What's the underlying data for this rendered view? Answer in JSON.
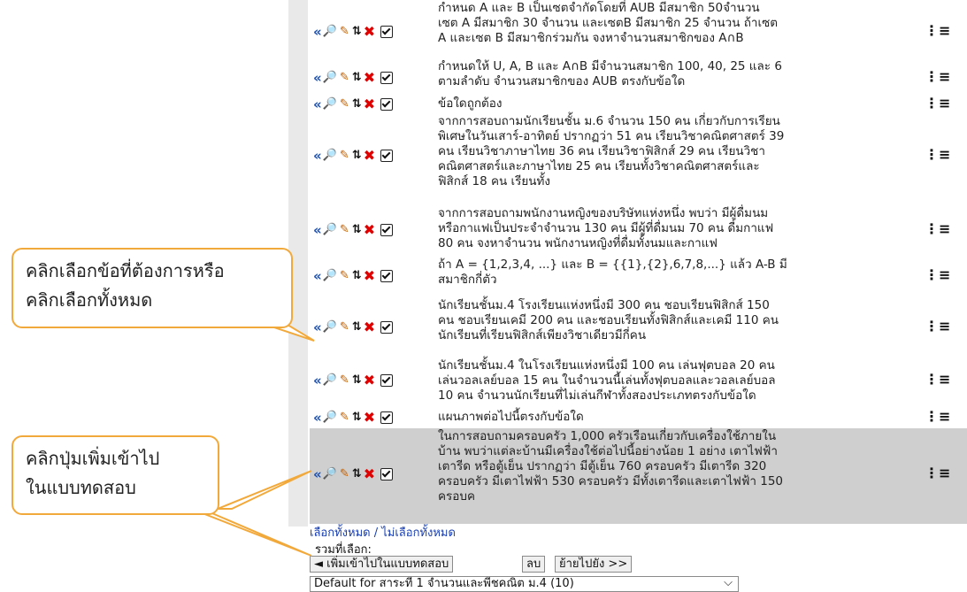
{
  "questions": [
    {
      "text": "กำหนด A และ B เป็นเซตจำกัดโดยที่ AUB มีสมาชิก 50จำนวน\nเซต A มีสมาชิก 30 จำนวน และเซตB มีสมาชิก 25 จำนวน ถ้าเซต\nA และเซต B มีสมาชิกร่วมกัน จงหาจำนวนสมาชิกของ A∩B"
    },
    {
      "text": "กำหนดให้ U, A, B และ A∩B มีจำนวนสมาชิก 100, 40, 25 และ 6\nตามลำดับ จำนวนสมาชิกของ AUB ตรงกับข้อใด"
    },
    {
      "text": "ข้อใดถูกต้อง"
    },
    {
      "text": "จากการสอบถามนักเรียนชั้น ม.6 จำนวน 150 คน เกี่ยวกับการเรียน\nพิเศษในวันเสาร์-อาทิตย์ ปรากฏว่า 51 คน เรียนวิชาคณิตศาสตร์ 39\nคน เรียนวิชาภาษาไทย 36 คน เรียนวิชาฟิสิกส์ 29 คน เรียนวิชา\nคณิตศาสตร์และภาษาไทย 25 คน เรียนทั้งวิชาคณิตศาสตร์และ\nฟิสิกส์ 18 คน เรียนทั้ง"
    },
    {
      "text": "จากการสอบถามพนักงานหญิงของบริษัทแห่งหนึ่ง พบว่า มีผู้ดื่มนม\nหรือกาแฟเป็นประจำจำนวน 130 คน มีผู้ที่ดื่มนม 70 คน ดื่มกาแฟ\n80 คน จงหาจำนวน พนักงานหญิงที่ดื่มทั้งนมและกาแฟ"
    },
    {
      "text": "ถ้า A = {1,2,3,4, ...} และ B = {{1},{2},6,7,8,...} แล้ว A-B มี\nสมาชิกกี่ตัว"
    },
    {
      "text": "นักเรียนชั้นม.4 โรงเรียนแห่งหนึ่งมี 300 คน ชอบเรียนฟิสิกส์ 150\nคน ชอบเรียนเคมี 200 คน และชอบเรียนทั้งฟิสิกส์และเคมี 110 คน\nนักเรียนที่เรียนฟิสิกส์เพียงวิชาเดียวมีกี่คน"
    },
    {
      "text": "นักเรียนชั้นม.4 ในโรงเรียนแห่งหนึ่งมี 100 คน เล่นฟุตบอล 20 คน\nเล่นวอลเลย์บอล 15 คน ในจำนวนนี้เล่นทั้งฟุตบอลและวอลเลย์บอล\n10 คน จำนวนนักเรียนที่ไม่เล่นกีฬาทั้งสองประเภทตรงกับข้อใด"
    },
    {
      "text": "แผนภาพต่อไปนี้ตรงกับข้อใด"
    },
    {
      "text": "ในการสอบถามครอบครัว 1,000 ครัวเรือนเกี่ยวกับเครื่องใช้ภายใน\nบ้าน พบว่าแต่ละบ้านมีเครื่องใช้ต่อไปนี้อย่างน้อย 1 อย่าง เตาไฟฟ้า\nเตารีด หรือตู้เย็น ปรากฏว่า มีตู้เย็น 760 ครอบครัว มีเตารีด 320\nครอบครัว มีเตาไฟฟ้า 530 ครอบครัว มีทั้งเตารีดและเตาไฟฟ้า 150\nครอบค"
    }
  ],
  "icons": {
    "back": "«",
    "zoom": "🔎",
    "edit": "✎",
    "move": "⇅",
    "delete": "✖",
    "menu": "⋮≡"
  },
  "links": {
    "select_all": "เลือกทั้งหมด",
    "separator": " / ",
    "deselect_all": "ไม่เลือกทั้งหมด"
  },
  "total_label": "รวมที่เลือก:",
  "buttons": {
    "add": "◄ เพิ่มเข้าไปในแบบทดสอบ",
    "delete": "ลบ",
    "move": "ย้ายไปยัง >>"
  },
  "category_select": "Default for สาระที่ 1 จำนวนและพีชคณิต ม.4 (10)",
  "callouts": {
    "select": "คลิกเลือกข้อที่ต้องการหรือ\nคลิกเลือกทั้งหมด",
    "add": "คลิกปุ่มเพิ่มเข้าไป\nในแบบทดสอบ"
  },
  "colors": {
    "accent": "#f2a93b",
    "link": "#1a3fb0",
    "selected_row": "#cfcfcf"
  }
}
